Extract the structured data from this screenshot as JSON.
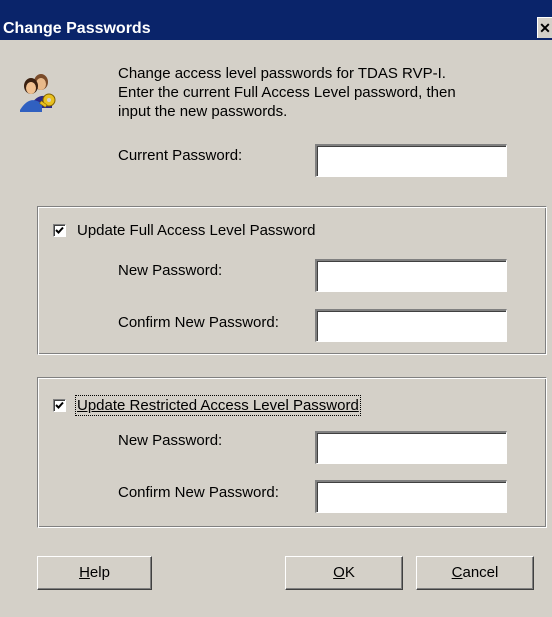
{
  "window": {
    "title": "Change Passwords",
    "close_glyph": "✕"
  },
  "intro": {
    "line1": "Change access level passwords for TDAS RVP-I.",
    "line2": "Enter the current Full Access Level password, then",
    "line3": "input the new passwords.",
    "icon": "users-key-icon"
  },
  "current": {
    "label": "Current Password:",
    "value": ""
  },
  "full_access": {
    "checkbox_label": "Update Full Access Level Password",
    "checked": true,
    "new_label": "New Password:",
    "new_value": "",
    "confirm_label": "Confirm New Password:",
    "confirm_value": ""
  },
  "restricted_access": {
    "checkbox_label": "Update Restricted Access Level Password",
    "checked": true,
    "new_label": "New Password:",
    "new_value": "",
    "confirm_label": "Confirm New Password:",
    "confirm_value": ""
  },
  "buttons": {
    "help_accel": "H",
    "help_rest": "elp",
    "ok_accel": "O",
    "ok_rest": "K",
    "cancel_accel": "C",
    "cancel_rest": "ancel"
  },
  "colors": {
    "titlebar": "#0a246a",
    "face": "#d4d0c8"
  }
}
